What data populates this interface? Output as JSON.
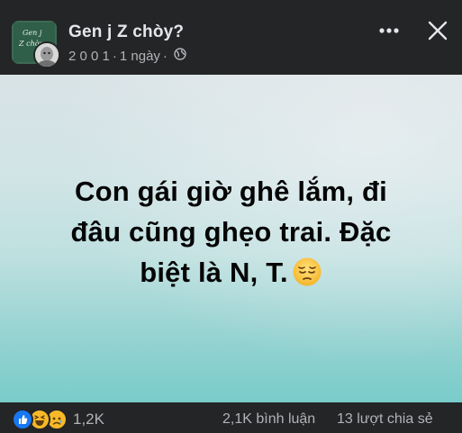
{
  "header": {
    "page_name": "Gen j Z chòy?",
    "author_name": "2 0 0 1",
    "separator": "·",
    "time": "1 ngày",
    "group_avatar_text": [
      "Gen j",
      "Z chòy"
    ]
  },
  "post": {
    "lines": [
      "Con gái giờ ghê lắm, đi",
      "đâu cũng ghẹo trai. Đặc",
      "biệt là N, T."
    ],
    "emoji": "pensive-face",
    "background_gradient": [
      "#d9e3e6",
      "#79cccb"
    ]
  },
  "footer": {
    "reaction_icons": [
      "like-icon",
      "haha-icon",
      "sad-icon"
    ],
    "reaction_count": "1,2K",
    "comments": "2,1K bình luận",
    "shares": "13 lượt chia sẻ"
  },
  "colors": {
    "background": "#242526",
    "text_primary": "#e4e6eb",
    "text_secondary": "#b0b3b8",
    "like_blue": "#1877f2",
    "reaction_yellow": "#f7b928"
  }
}
